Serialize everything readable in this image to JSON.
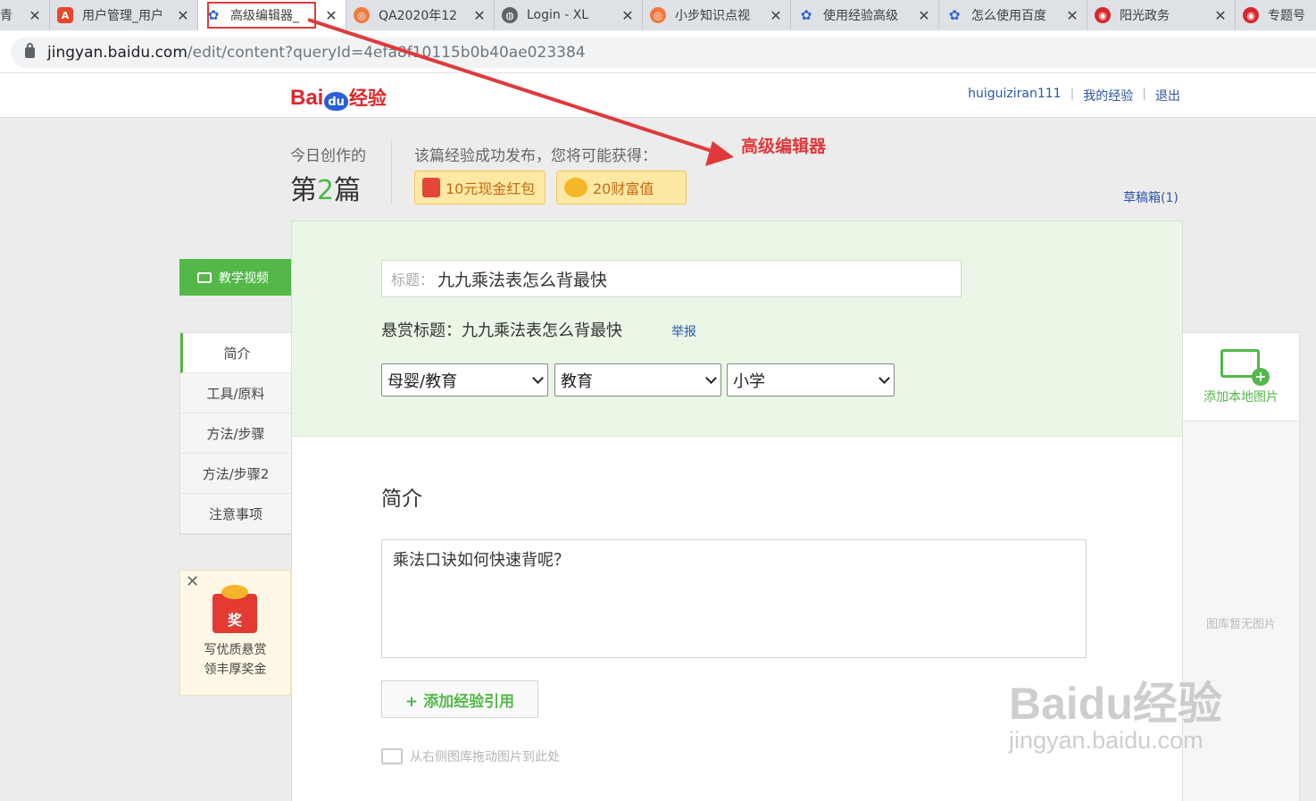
{
  "browser": {
    "tabs": [
      {
        "title": "青",
        "icon": "tab-icon"
      },
      {
        "title": "用户管理_用户",
        "icon": "a-app-icon"
      },
      {
        "title": "高级编辑器_",
        "icon": "baidu-paw-icon"
      },
      {
        "title": "QA2020年12",
        "icon": "orange-app-icon"
      },
      {
        "title": "Login - XL",
        "icon": "globe-icon"
      },
      {
        "title": "小步知识点视",
        "icon": "orange-app-icon"
      },
      {
        "title": "使用经验高级",
        "icon": "baidu-paw-icon"
      },
      {
        "title": "怎么使用百度",
        "icon": "baidu-paw-icon"
      },
      {
        "title": "阳光政务",
        "icon": "red-gov-icon"
      },
      {
        "title": "专题号",
        "icon": "red-gov-icon"
      }
    ],
    "close_glyph": "✕",
    "url_host": "jingyan.baidu.com",
    "url_path": "/edit/content?queryId=4efa8f10115b0b40ae023384"
  },
  "header": {
    "logo_bai": "Bai",
    "logo_du": "du",
    "logo_jy": "经验",
    "username": "huiguiziran111",
    "my_link": "我的经验",
    "logout": "退出",
    "separator": "|"
  },
  "stats": {
    "today_label": "今日创作的",
    "count_prefix": "第",
    "count_num": "2",
    "count_suffix": "篇",
    "reward_title": "该篇经验成功发布，您将可能获得：",
    "badge_cash": "10元现金红包",
    "badge_wealth": "20财富值",
    "drafts": "草稿箱(1)"
  },
  "sidenav": {
    "video_label": "教学视频",
    "items": [
      {
        "label": "简介"
      },
      {
        "label": "工具/原料"
      },
      {
        "label": "方法/步骤"
      },
      {
        "label": "方法/步骤2"
      },
      {
        "label": "注意事项"
      }
    ]
  },
  "promo": {
    "envelope_char": "奖",
    "line1": "写优质悬赏",
    "line2": "领丰厚奖金",
    "close_glyph": "✕"
  },
  "editor": {
    "title_label": "标题：",
    "title_value": "九九乘法表怎么背最快",
    "reward_line": "悬赏标题：九九乘法表怎么背最快",
    "report": "举报",
    "category1": "母婴/教育",
    "category2": "教育",
    "category3": "小学",
    "section_title": "简介",
    "intro_text": "乘法口诀如何快速背呢？",
    "add_ref": "+ 添加经验引用",
    "drag_hint": "从右侧图库拖动图片到此处"
  },
  "image_panel": {
    "add_label": "添加本地图片",
    "empty_label": "图库暂无图片"
  },
  "annotation": {
    "text": "高级编辑器",
    "color": "#e0393b"
  },
  "watermark": {
    "logo": "Baidu经验",
    "url": "jingyan.baidu.com"
  }
}
